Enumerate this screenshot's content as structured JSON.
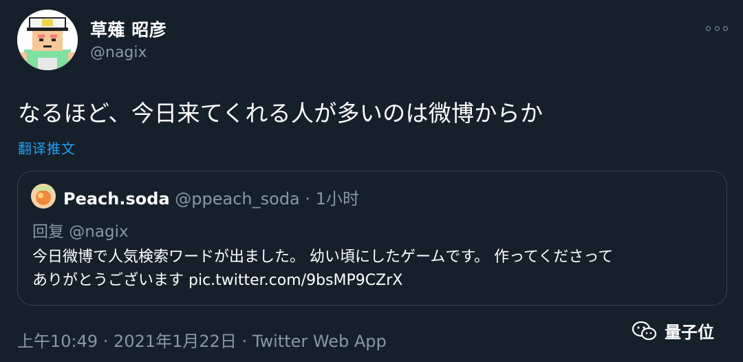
{
  "author": {
    "display_name": "草薙 昭彦",
    "handle": "@nagix"
  },
  "more_icon": "ellipsis-icon",
  "tweet": {
    "text": "なるほど、今日来てくれる人が多いのは微博からか",
    "translate_label": "翻译推文"
  },
  "quoted": {
    "name": "Peach.soda",
    "handle": "@ppeach_soda",
    "separator": "·",
    "time": "1小时",
    "reply_to": "回复 @nagix",
    "body_line1": "今日微博で人気検索ワードが出ました。 幼い頃にしたゲームです。 作ってくださって",
    "body_line2": "ありがとうございます pic.twitter.com/9bsMP9CZrX"
  },
  "footer": {
    "meta": "上午10:49 · 2021年1月22日 · Twitter Web App"
  },
  "watermark": {
    "icon": "wechat-icon",
    "text": "量子位"
  },
  "colors": {
    "background": "#15202b",
    "secondary_text": "#8899a6",
    "link": "#1da1f2",
    "border": "#38444d"
  }
}
